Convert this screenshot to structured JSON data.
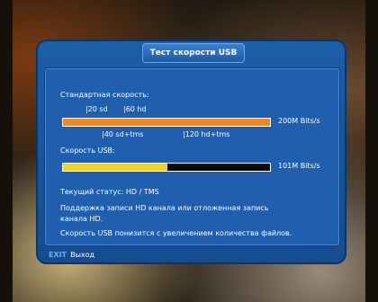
{
  "window": {
    "title": "Тест скорости USB"
  },
  "standard_speed": {
    "label": "Стандартная скорость:",
    "mark_sd": "|20 sd",
    "mark_hd": "|60 hd",
    "mark_sd_tms": "|40 sd+tms",
    "mark_hd_tms": "|120 hd+tms",
    "value": "200M Bits/s",
    "fill_fraction": 1.0,
    "fill_color": "#f08a1c"
  },
  "usb_speed": {
    "label": "Скорость USB:",
    "value": "101M Bits/s",
    "fill_fraction": 0.505,
    "fill_color": "#f2d21c"
  },
  "status": {
    "text": "Текущий статус: HD / TMS"
  },
  "messages": {
    "support_line1": "Поддержка записи HD канала или отложенная запись",
    "support_line2": "канала HD.",
    "usb_note": "Скорость USB понизится с увеличением количества файлов."
  },
  "footer": {
    "exit_key": "EXIT",
    "exit_label": "Выход"
  },
  "colors": {
    "panel": "#1c5ea8",
    "track": "#0a0a0a"
  }
}
